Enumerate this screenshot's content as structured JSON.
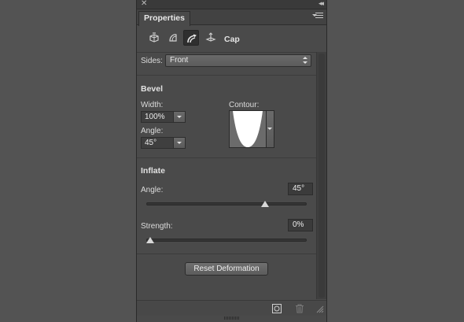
{
  "panel": {
    "tab_title": "Properties",
    "mode_label": "Cap",
    "icons": [
      "mesh-icon",
      "deform-icon",
      "cap-icon",
      "coordinates-icon"
    ]
  },
  "sides": {
    "label": "Sides:",
    "value": "Front"
  },
  "bevel": {
    "heading": "Bevel",
    "width_label": "Width:",
    "width_value": "100%",
    "angle_label": "Angle:",
    "angle_value": "45°",
    "contour_label": "Contour:"
  },
  "inflate": {
    "heading": "Inflate",
    "angle_label": "Angle:",
    "angle_value": "45°",
    "angle_fraction": 0.75,
    "strength_label": "Strength:",
    "strength_value": "0%",
    "strength_fraction": 0.0
  },
  "actions": {
    "reset_label": "Reset Deformation"
  },
  "colors": {
    "panel_bg": "#4a4a4a",
    "page_bg": "#535353",
    "active_icon_bg": "#2f2f2f"
  }
}
